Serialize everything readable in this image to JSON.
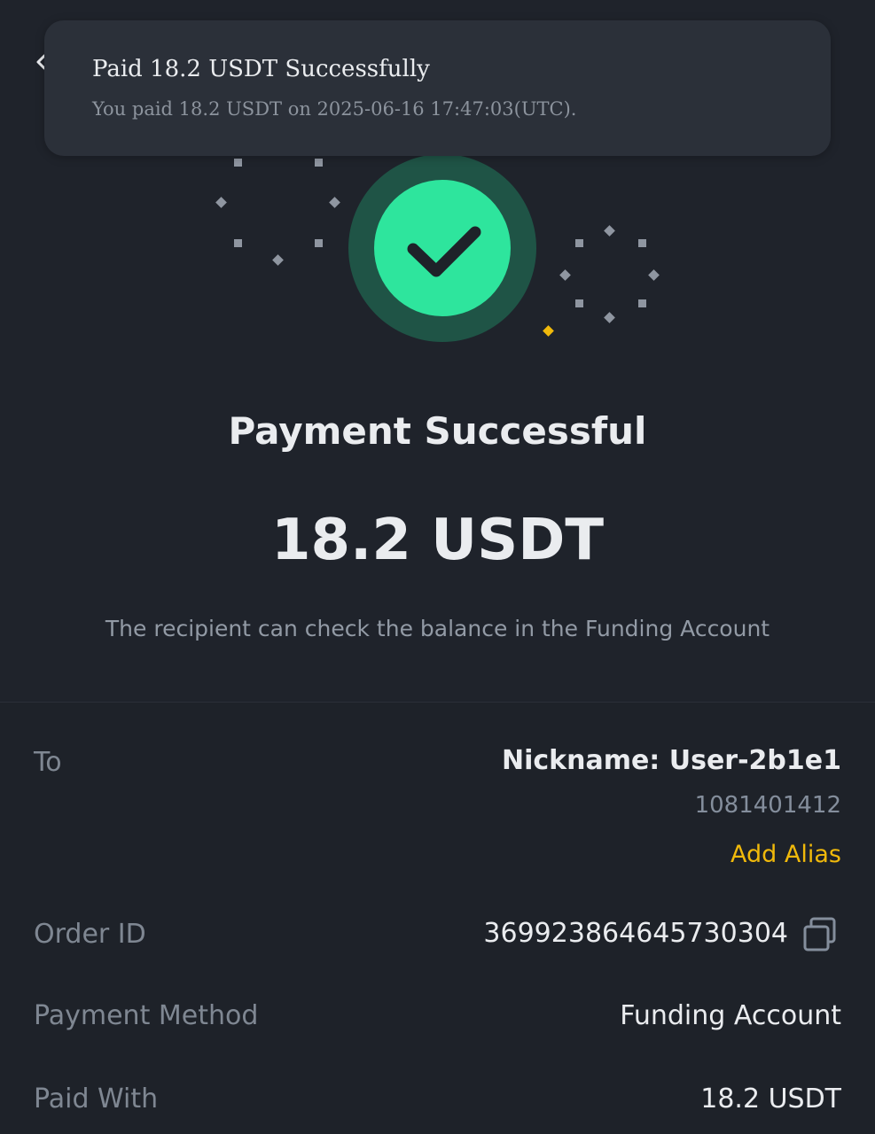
{
  "toast": {
    "title": "Paid 18.2 USDT Successfully",
    "message": "You paid 18.2 USDT on 2025-06-16 17:47:03(UTC)."
  },
  "status": {
    "title": "Payment Successful",
    "amount": "18.2 USDT",
    "note": "The recipient can check the balance in the Funding Account"
  },
  "details": {
    "to": {
      "label": "To",
      "nickname": "Nickname: User-2b1e1",
      "id": "1081401412",
      "add_alias": "Add Alias"
    },
    "order_id": {
      "label": "Order ID",
      "value": "369923864645730304"
    },
    "payment_method": {
      "label": "Payment Method",
      "value": "Funding Account"
    },
    "paid_with": {
      "label": "Paid With",
      "value": "18.2 USDT"
    }
  },
  "icons": {
    "back": "chevron-left-icon",
    "success": "check-circle-icon",
    "copy": "copy-icon"
  },
  "colors": {
    "background": "#1f232b",
    "toast_background": "#2b3039",
    "success_green": "#2ee59d",
    "success_ring": "#1f5446",
    "accent_yellow": "#f0b90b",
    "muted_text": "#7f8792"
  }
}
